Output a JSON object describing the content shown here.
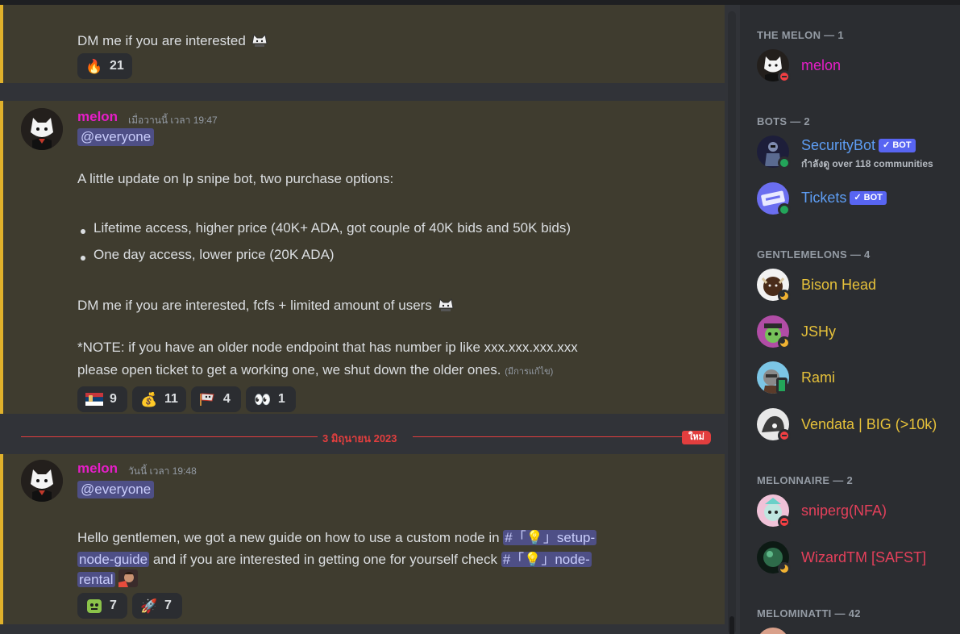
{
  "colors": {
    "accent_mention": "#e0b12b",
    "author": "#e61ec8",
    "new_divider": "#e23e3e",
    "bot_badge": "#5865f2"
  },
  "messages": [
    {
      "text": "DM me if you are interested",
      "reactions": [
        {
          "icon": "fire-icon",
          "emoji": "🔥",
          "count": "21"
        }
      ]
    },
    {
      "author": "melon",
      "timestamp": "เมื่อวานนี้ เวลา 19:47",
      "mention": "@everyone",
      "intro": "A little update on lp snipe bot, two purchase options:",
      "bullets": [
        "Lifetime access, higher price (40K+ ADA, got couple of 40K bids and 50K bids)",
        "One day access, lower price (20K ADA)"
      ],
      "dm_line": "DM me if you are interested, fcfs + limited amount of users",
      "note_line1": "*NOTE: if you have an older node endpoint that has number ip like xxx.xxx.xxx.xxx",
      "note_line2": "please open ticket to get a working one, we shut down the older ones.",
      "edited": "(มีการแก้ไข)",
      "reactions": [
        {
          "icon": "serbia-flag-icon",
          "emoji": "🇷🇸",
          "count": "9"
        },
        {
          "icon": "money-bag-icon",
          "emoji": "💰",
          "count": "11"
        },
        {
          "icon": "melon-flag-icon",
          "emoji": "",
          "count": "4"
        },
        {
          "icon": "eyes-icon",
          "emoji": "👀",
          "count": "1"
        }
      ]
    },
    {
      "author": "melon",
      "timestamp": "วันนี้ เวลา 19:48",
      "mention": "@everyone",
      "line1_a": "Hello gentlemen, we got a new guide on how to use a custom node in",
      "channel1_a": "#「💡」setup-",
      "channel1_b": "node-guide",
      "line2_a": "and if you are interested in getting one for yourself check",
      "channel2_a": "#「💡」node-",
      "channel2_b": "rental",
      "reactions": [
        {
          "icon": "green-blob-icon",
          "emoji": "",
          "count": "7"
        },
        {
          "icon": "rocket-icon",
          "emoji": "🚀",
          "count": "7"
        }
      ]
    }
  ],
  "divider": {
    "date": "3 มิถุนายน 2023",
    "badge": "ใหม่"
  },
  "members": {
    "categories": [
      {
        "label": "THE MELON — 1"
      },
      {
        "label": "BOTS — 2"
      },
      {
        "label": "GENTLEMELONS — 4"
      },
      {
        "label": "MELONNAIRE — 2"
      },
      {
        "label": "MELOMINATTI — 42"
      }
    ],
    "list": [
      {
        "name": "melon",
        "color": "#e61ec8",
        "status": "dnd"
      },
      {
        "name": "SecurityBot",
        "color": "#5e9ef5",
        "status": "online",
        "bot": "BOT",
        "sub": "กำลังดู over 118 communities"
      },
      {
        "name": "Tickets",
        "color": "#5e9ef5",
        "status": "online",
        "bot": "BOT"
      },
      {
        "name": "Bison Head",
        "color": "#e6c13a",
        "status": "idle"
      },
      {
        "name": "JSHy",
        "color": "#e6c13a",
        "status": "idle"
      },
      {
        "name": "Rami",
        "color": "#e6c13a",
        "status": "mobile"
      },
      {
        "name": "Vendata | BIG (>10k)",
        "color": "#e6c13a",
        "status": "dnd"
      },
      {
        "name": "sniperg(NFA)",
        "color": "#e5405b",
        "status": "dnd"
      },
      {
        "name": "WizardTM [SAFST]",
        "color": "#e5405b",
        "status": "idle"
      }
    ]
  }
}
